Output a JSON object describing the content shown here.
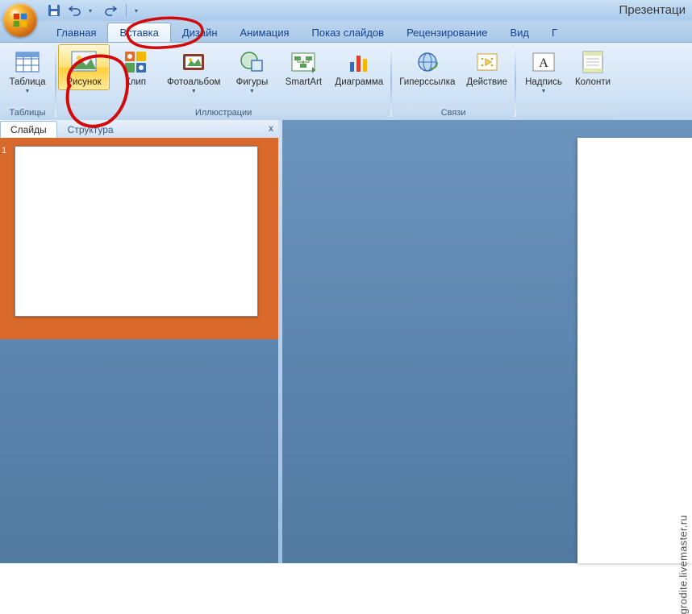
{
  "title": "Презентаци",
  "qat": {
    "save": "save",
    "undo": "undo",
    "redo": "redo"
  },
  "tabs": [
    "Главная",
    "Вставка",
    "Дизайн",
    "Анимация",
    "Показ слайдов",
    "Рецензирование",
    "Вид",
    "Г"
  ],
  "active_tab_index": 1,
  "ribbon": {
    "groups": [
      {
        "label": "Таблицы",
        "items": [
          {
            "name": "table-button",
            "label": "Таблица",
            "dropdown": true,
            "icon": "table"
          }
        ]
      },
      {
        "label": "Иллюстрации",
        "items": [
          {
            "name": "picture-button",
            "label": "Рисунок",
            "dropdown": false,
            "icon": "picture",
            "highlight": true
          },
          {
            "name": "clip-button",
            "label": "Клип",
            "dropdown": false,
            "icon": "clip"
          },
          {
            "name": "photoalbum-button",
            "label": "Фотоальбом",
            "dropdown": true,
            "icon": "photoalbum"
          },
          {
            "name": "shapes-button",
            "label": "Фигуры",
            "dropdown": true,
            "icon": "shapes"
          },
          {
            "name": "smartart-button",
            "label": "SmartArt",
            "dropdown": false,
            "icon": "smartart"
          },
          {
            "name": "chart-button",
            "label": "Диаграмма",
            "dropdown": false,
            "icon": "chart"
          }
        ]
      },
      {
        "label": "Связи",
        "items": [
          {
            "name": "hyperlink-button",
            "label": "Гиперссылка",
            "dropdown": false,
            "icon": "hyperlink"
          },
          {
            "name": "action-button",
            "label": "Действие",
            "dropdown": false,
            "icon": "action"
          }
        ]
      },
      {
        "label": "",
        "items": [
          {
            "name": "textbox-button",
            "label": "Надпись",
            "dropdown": false,
            "icon": "textbox"
          },
          {
            "name": "headerfooter-button",
            "label": "Колонти",
            "dropdown": false,
            "icon": "headerfooter"
          }
        ]
      }
    ]
  },
  "panel": {
    "tabs": [
      "Слайды",
      "Структура"
    ],
    "active": 0,
    "close": "x"
  },
  "slide_number": "1",
  "watermark": "grodite.livemaster.ru"
}
